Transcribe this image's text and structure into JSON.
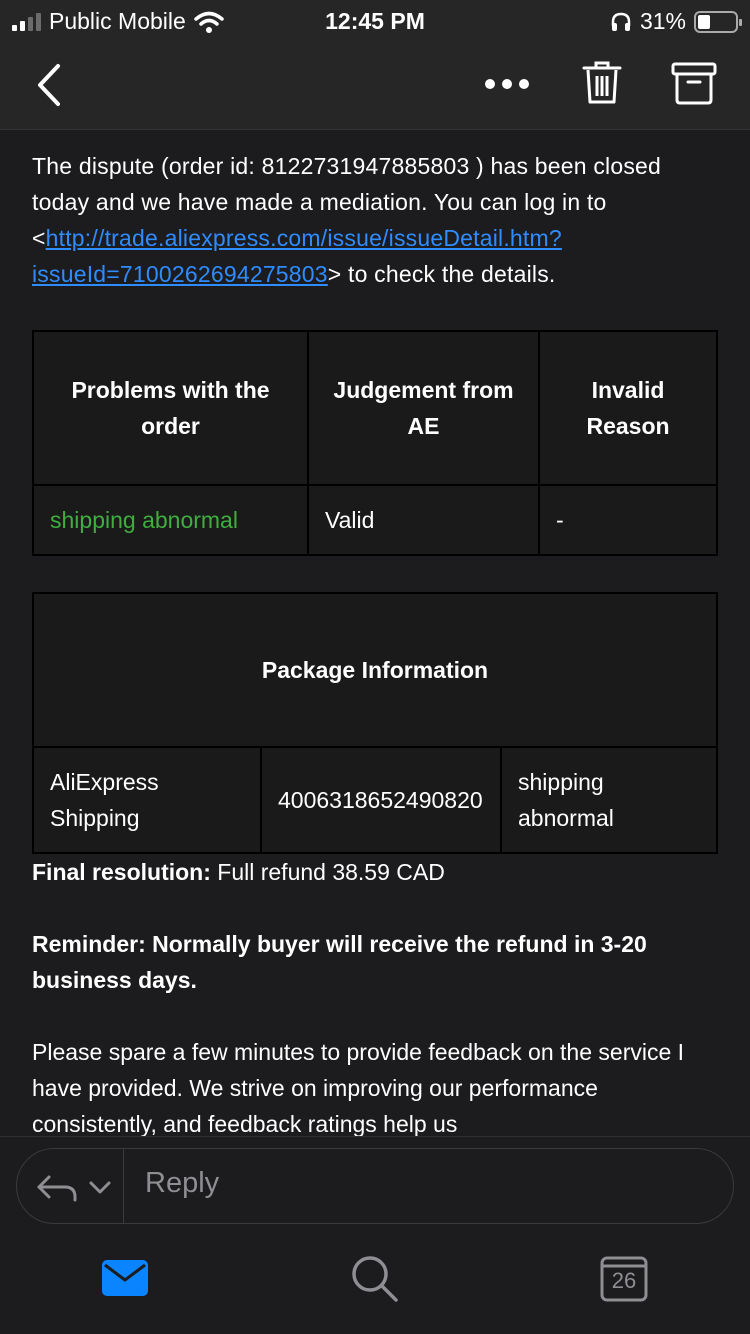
{
  "status": {
    "carrier": "Public Mobile",
    "time": "12:45 PM",
    "battery": "31%",
    "battery_level": 0.31
  },
  "email": {
    "intro_1": "The dispute (order id: 8122731947885803 ) has been closed today and we have made a mediation. You can log in to <",
    "link": "http://trade.aliexpress.com/issue/issueDetail.htm?issueId=7100262694275803",
    "intro_2": "> to check the details.",
    "table1": {
      "headers": [
        "Problems with the order",
        "Judgement from AE",
        "Invalid Reason"
      ],
      "row": [
        "shipping abnormal",
        "Valid",
        "-"
      ]
    },
    "table2": {
      "header": "Package Information",
      "row": [
        "AliExpress Shipping",
        "4006318652490820",
        "shipping abnormal"
      ]
    },
    "final_label": "Final resolution:",
    "final_value": " Full refund 38.59 CAD",
    "reminder": "Reminder: Normally buyer will receive the refund in 3-20 business days.",
    "feedback": "Please spare a few minutes to provide feedback on the service I have provided. We strive on improving our performance consistently, and feedback ratings help us"
  },
  "reply": {
    "placeholder": "Reply"
  },
  "tabs": {
    "calendar_day": "26"
  },
  "colors": {
    "link": "#2f8cff",
    "green": "#3fae3f",
    "accent": "#0a84ff"
  }
}
